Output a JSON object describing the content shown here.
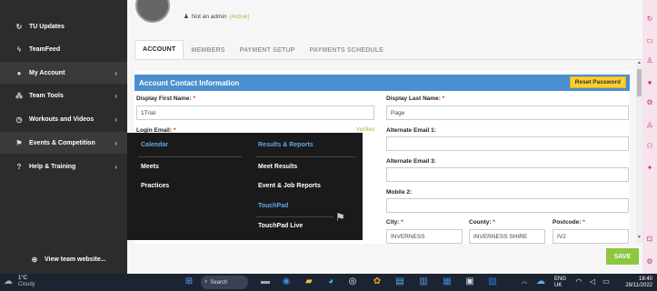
{
  "sidebar": {
    "items": [
      {
        "label": "TU Updates",
        "icon": "refresh-icon",
        "arrow": ""
      },
      {
        "label": "TeamFeed",
        "icon": "flame-icon",
        "arrow": ""
      },
      {
        "label": "My Account",
        "icon": "user-circle-icon",
        "arrow": "›"
      },
      {
        "label": "Team Tools",
        "icon": "team-icon",
        "arrow": "›"
      },
      {
        "label": "Workouts and Videos",
        "icon": "stopwatch-icon",
        "arrow": "›"
      },
      {
        "label": "Events & Competition",
        "icon": "flag-icon",
        "arrow": "›"
      },
      {
        "label": "Help & Training",
        "icon": "question-icon",
        "arrow": "›"
      }
    ],
    "view_site_label": "View team website..."
  },
  "user": {
    "admin_status": "Not an admin",
    "active_status": "(Active)"
  },
  "tabs": [
    "ACCOUNT",
    "MEMBERS",
    "PAYMENT SETUP",
    "PAYMENTS SCHEDULE"
  ],
  "panel": {
    "title": "Account Contact Information",
    "reset_button": "Reset Password"
  },
  "fields": {
    "first_name_label": "Display First Name:",
    "first_name_value": "1Trial",
    "last_name_label": "Display Last Name:",
    "last_name_value": "Page",
    "login_email_label": "Login Email:",
    "verified": "Verified",
    "alt_email1_label": "Alternate Email 1:",
    "alt_email3_label": "Alternate Email 3:",
    "mobile2_label": "Mobile 2:",
    "city_label": "City:",
    "city_value": "INVERNESS",
    "county_label": "County:",
    "county_value": "INVERNESS SHIRE",
    "postcode_label": "Postcode:",
    "postcode_value": "IV2",
    "required_mark": "*"
  },
  "save_button": "SAVE",
  "dropdown": {
    "col1_header": "Calendar",
    "col1_items": [
      "Meets",
      "Practices"
    ],
    "col2_header": "Results & Reports",
    "col2_items": [
      "Meet Results",
      "Event & Job Reports"
    ],
    "col2_subheader": "TouchPad",
    "col2_subitems": [
      "TouchPad Live"
    ]
  },
  "taskbar": {
    "temperature": "1°C",
    "condition": "Cloudy",
    "search_label": "Search",
    "lang_top": "ENG",
    "lang_bottom": "UK",
    "time": "18:40",
    "date": "28/11/2022"
  },
  "colors": {
    "sidebar_bg": "#2c2c2c",
    "header_blue": "#4a8fcf",
    "reset_yellow": "#ffce35",
    "save_green": "#8dc63f",
    "dropdown_bg": "#1a1a1a",
    "dropdown_accent": "#5fa8e8"
  }
}
